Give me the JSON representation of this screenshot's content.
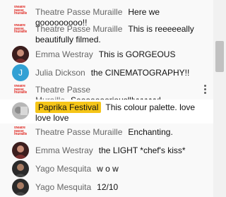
{
  "messages": [
    {
      "author": "Theatre Passe Muraille",
      "text": "Here we gooooooooo!!",
      "avatar": "theatre-logo"
    },
    {
      "author": "Theatre Passe Muraille",
      "text": "This is reeeeeally beautifully filmed.",
      "avatar": "theatre-logo"
    },
    {
      "author": "Emma Westray",
      "text": "This is GORGEOUS",
      "avatar": "photo"
    },
    {
      "author": "Julia Dickson",
      "text": "the CINEMATOGRAPHY!!",
      "avatar": "initial",
      "initial": "J"
    },
    {
      "author": "Theatre Passe Muraille",
      "text": "Seeeeeeeriouslllyyyyyy!",
      "avatar": "theatre-logo"
    },
    {
      "author": "Paprika Festival",
      "text": "This colour palette. love love love",
      "avatar": "photo",
      "highlight": true
    },
    {
      "author": "Theatre Passe Muraille",
      "text": "Enchanting.",
      "avatar": "theatre-logo"
    },
    {
      "author": "Emma Westray",
      "text": "the LIGHT *chef's kiss*",
      "avatar": "photo"
    },
    {
      "author": "Yago Mesquita",
      "text": "w o w",
      "avatar": "photo"
    },
    {
      "author": "Yago Mesquita",
      "text": "12/10",
      "avatar": "photo"
    }
  ],
  "logo_text": "theatre passe muraille",
  "colors": {
    "background": "#f9f9f9",
    "highlight_bg": "#ffffff",
    "pill": "#f5c518",
    "logo_red": "#e0312b",
    "author_gray": "#666666",
    "julia_avatar": "#33a1d4"
  }
}
